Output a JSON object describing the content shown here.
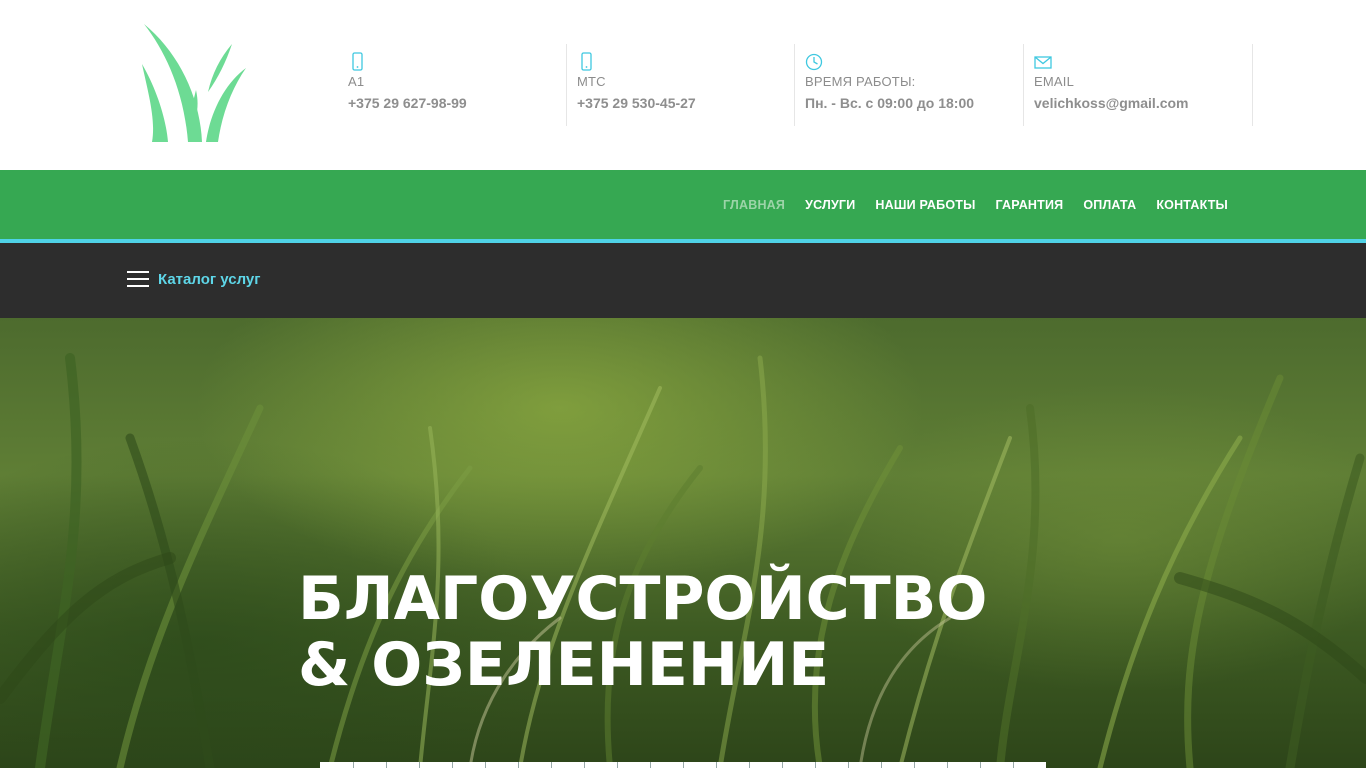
{
  "header": {
    "logo_icon": "grass-logo-icon",
    "contacts": [
      {
        "icon": "mobile-phone-icon",
        "label": "A1",
        "value": "+375 29 627-98-99"
      },
      {
        "icon": "mobile-phone-icon",
        "label": "МТС",
        "value": "+375 29 530-45-27"
      },
      {
        "icon": "clock-icon",
        "label": "ВРЕМЯ РАБОТЫ:",
        "value": "Пн. - Вс. с 09:00 до 18:00"
      },
      {
        "icon": "envelope-icon",
        "label": "EMAIL",
        "value": "velichkoss@gmail.com"
      }
    ]
  },
  "nav": {
    "items": [
      {
        "label": "ГЛАВНАЯ",
        "active": true
      },
      {
        "label": "УСЛУГИ"
      },
      {
        "label": "НАШИ РАБОТЫ"
      },
      {
        "label": "ГАРАНТИЯ"
      },
      {
        "label": "ОПЛАТА"
      },
      {
        "label": "КОНТАКТЫ"
      }
    ]
  },
  "catalog": {
    "label": "Каталог услуг",
    "icon": "hamburger-menu-icon"
  },
  "hero": {
    "title_line1": "БЛАГОУСТРОЙСТВО",
    "title_line2": "& ОЗЕЛЕНЕНИЕ"
  },
  "colors": {
    "nav_green": "#36a852",
    "accent_cyan": "#4fd2e6",
    "catalog_bar": "#2d2d2d",
    "logo_green": "#6ddb94",
    "icon_cyan": "#3fc8e0"
  }
}
